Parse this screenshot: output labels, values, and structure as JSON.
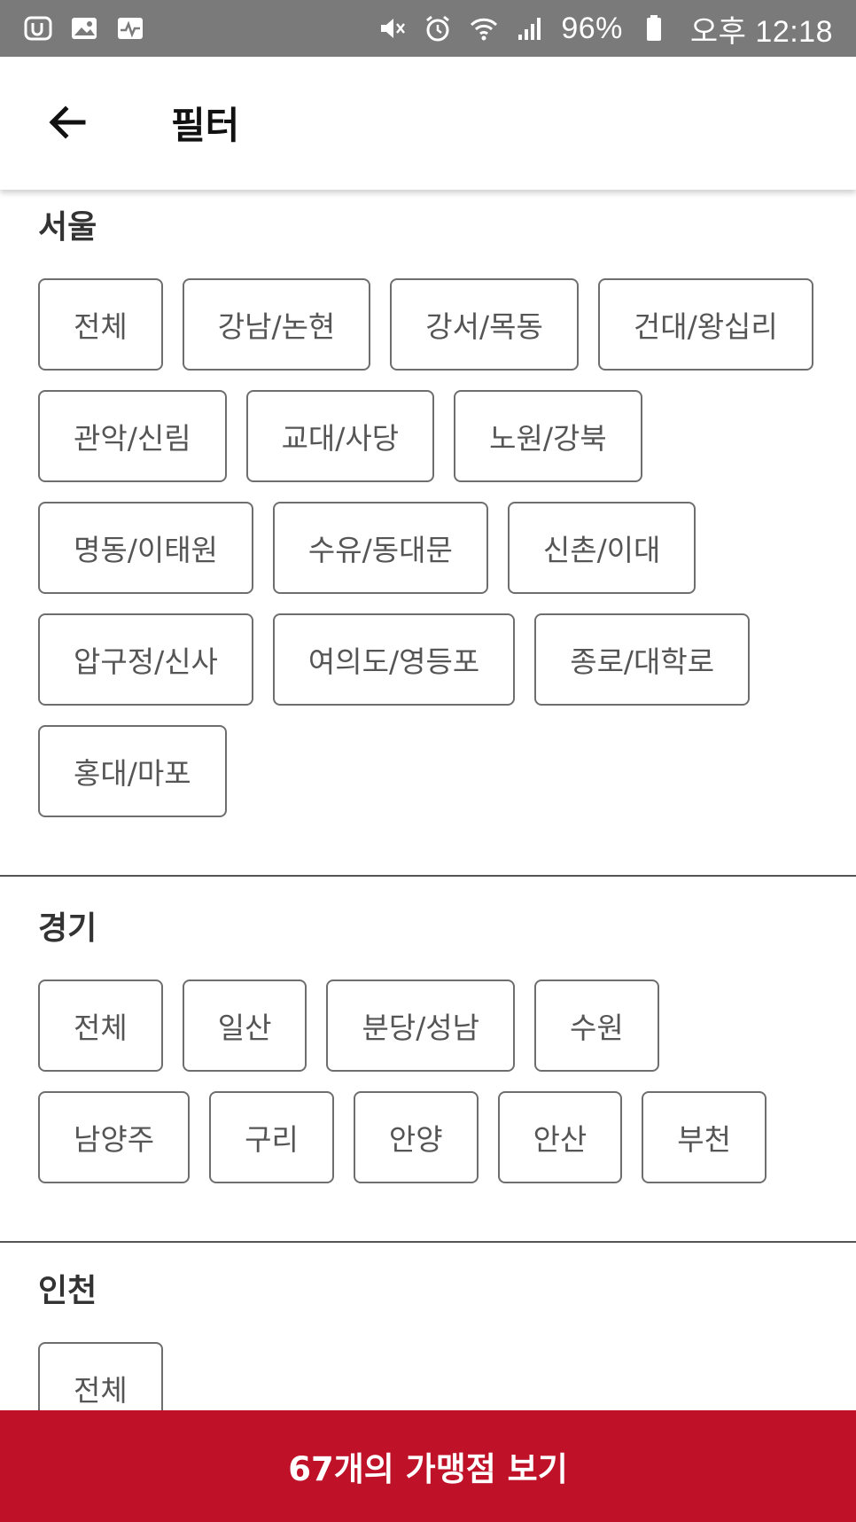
{
  "status_bar": {
    "battery": "96%",
    "time": "오후 12:18",
    "icons_left": [
      "u-plus-icon",
      "image-icon",
      "pulse-icon"
    ],
    "icons_right": [
      "mute-icon",
      "alarm-icon",
      "wifi-icon",
      "signal-icon",
      "battery-icon"
    ]
  },
  "app_bar": {
    "title": "필터"
  },
  "sections": [
    {
      "title": "서울",
      "chips": [
        "전체",
        "강남/논현",
        "강서/목동",
        "건대/왕십리",
        "관악/신림",
        "교대/사당",
        "노원/강북",
        "명동/이태원",
        "수유/동대문",
        "신촌/이대",
        "압구정/신사",
        "여의도/영등포",
        "종로/대학로",
        "홍대/마포"
      ]
    },
    {
      "title": "경기",
      "chips": [
        "전체",
        "일산",
        "분당/성남",
        "수원",
        "남양주",
        "구리",
        "안양",
        "안산",
        "부천"
      ]
    },
    {
      "title": "인천",
      "chips": [
        "전체"
      ]
    }
  ],
  "cta": {
    "label": "67개의 가맹점 보기"
  },
  "colors": {
    "status_bar": "#7a7a7a",
    "cta": "#bf1229",
    "chip_border": "#6e6e6e"
  }
}
